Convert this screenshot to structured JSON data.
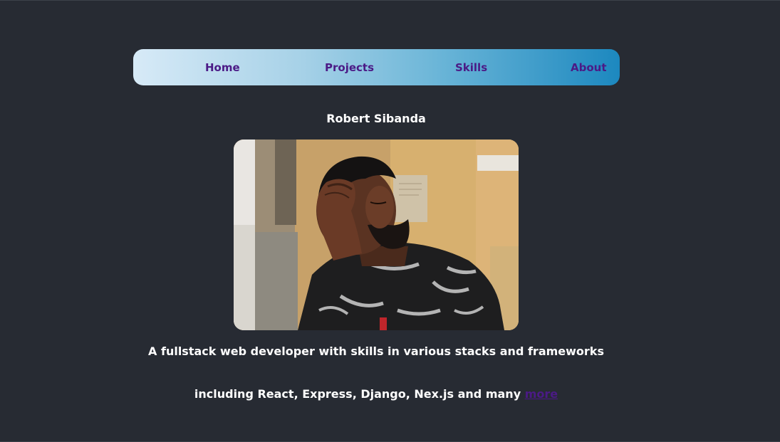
{
  "nav": {
    "items": [
      {
        "label": "Home"
      },
      {
        "label": "Projects"
      },
      {
        "label": "Skills"
      },
      {
        "label": "About"
      }
    ]
  },
  "profile": {
    "name": "Robert Sibanda",
    "photo_icon": "profile-photo",
    "intro_line_1": "A fullstack web developer with skills in various stacks and frameworks",
    "intro_line_2": "including React, Express, Django, Nex.js and many",
    "more_label": "more"
  },
  "colors": {
    "background": "#272b33",
    "nav_gradient_start": "#d7eaf7",
    "nav_gradient_end": "#1c88bf",
    "link": "#4b1a86",
    "text": "#ffffff"
  }
}
